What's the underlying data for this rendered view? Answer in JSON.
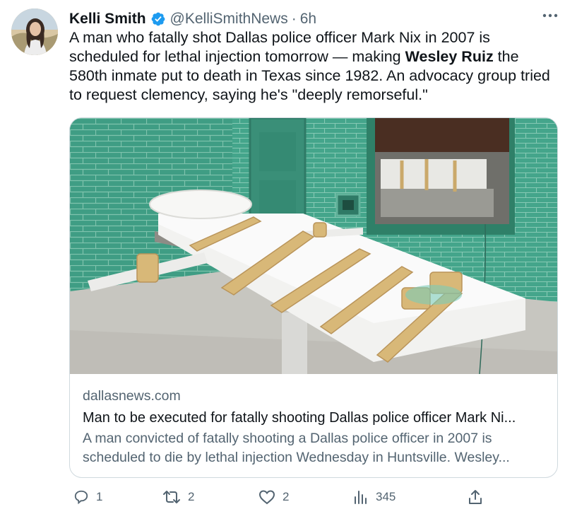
{
  "author": {
    "name": "Kelli Smith",
    "handle": "@KelliSmithNews",
    "separator": "·",
    "time": "6h",
    "verified_icon": "verified-badge-icon",
    "avatar": "author-avatar"
  },
  "tweet": {
    "text_before": "A man who fatally shot Dallas police officer Mark Nix in 2007 is scheduled for lethal injection tomorrow — making ",
    "text_bold": "Wesley Ruiz",
    "text_after": " the 580th inmate put to death in Texas since 1982. An advocacy group tried to request clemency, saying he's \"deeply remorseful.\""
  },
  "card": {
    "image": "execution-chamber-photo",
    "domain": "dallasnews.com",
    "title": "Man to be executed for fatally shooting Dallas police officer Mark Ni...",
    "description": "A man convicted of fatally shooting a Dallas police officer in 2007 is scheduled to die by lethal injection Wednesday in Huntsville. Wesley..."
  },
  "actions": {
    "replies": "1",
    "retweets": "2",
    "likes": "2",
    "views": "345"
  },
  "colors": {
    "text": "#0f1419",
    "secondary": "#536471",
    "verified": "#1d9bf0",
    "border": "#cfd9de"
  }
}
